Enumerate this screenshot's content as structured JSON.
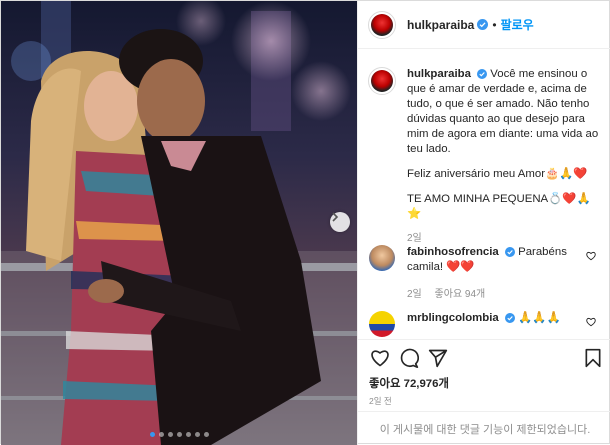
{
  "header": {
    "username": "hulkparaiba",
    "separator": "•",
    "follow_label": "팔로우"
  },
  "caption": {
    "username": "hulkparaiba",
    "text1": "Você me ensinou o que é amar de verdade e, acima de tudo, o que é ser amado. Não tenho dúvidas quanto ao que desejo para mim de agora em diante: uma vida ao teu lado.",
    "text2": "Feliz aniversário meu Amor🎂🙏❤️",
    "text3": "TE AMO MINHA PEQUENA💍❤️🙏⭐",
    "age": "2일"
  },
  "comments": [
    {
      "username": "fabinhosofrencia",
      "text": "Parabéns camila! ❤️❤️",
      "age": "2일",
      "likes": "좋아요 94개"
    },
    {
      "username": "mrblingcolombia",
      "text": "🙏🙏🙏"
    }
  ],
  "post": {
    "likes": "좋아요 72,976개",
    "time": "2일 전",
    "comments_disabled": "이 게시물에 대한 댓글 기능이 제한되었습니다."
  },
  "carousel": {
    "total_slides": 7,
    "active_slide": 1
  },
  "colors": {
    "accent": "#0095f6",
    "verified": "#3897f0",
    "heart": "#ed4956"
  }
}
